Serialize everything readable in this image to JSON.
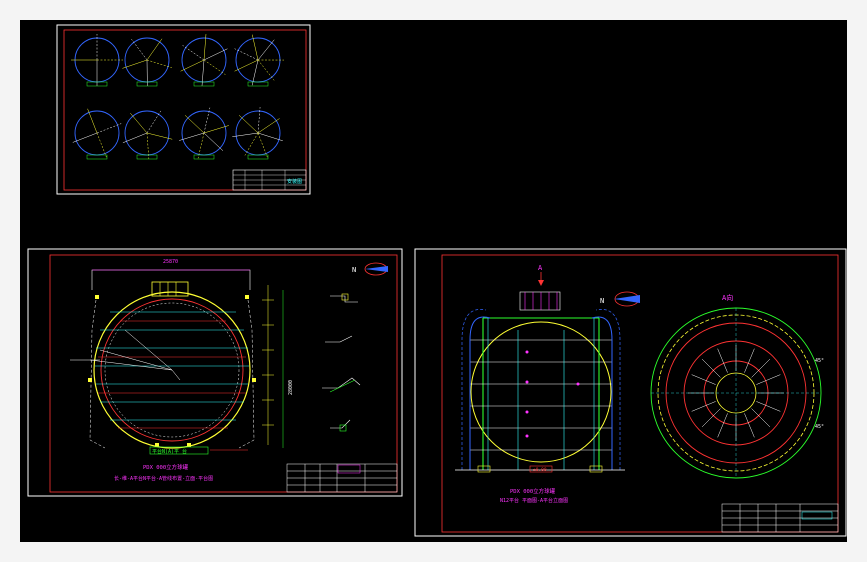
{
  "app": {
    "title": "",
    "background": "#000000",
    "frame_color": "#f4f4f4"
  },
  "colors": {
    "sheet_border": "#ffffff",
    "inner_border": "#ff2a2a",
    "green": "#2bff2b",
    "yellow": "#ffff33",
    "cyan": "#33ffff",
    "magenta": "#ff33ff",
    "red": "#ff3333",
    "blue": "#3366ff",
    "white": "#ffffff"
  },
  "sheets": {
    "details": {
      "title_block_label": "安装图"
    },
    "plan": {
      "north_label": "N",
      "main_label": "PDX 000立方球罐",
      "sub_label": "长-维-A平台N平台-A管线布置-立面-平台图",
      "dim_top": "25870",
      "dim_side": "28000",
      "bottom_note": "平台N(A)平 台"
    },
    "elevation": {
      "marker_top": "A",
      "north_label": "N",
      "view_label": "A向",
      "main_label": "PDX 000立方球罐",
      "sub_label": "N12平台 平面图-A平台立面图",
      "foot_label": "±0.00",
      "angle_1": "45°",
      "angle_2": "45°"
    }
  }
}
